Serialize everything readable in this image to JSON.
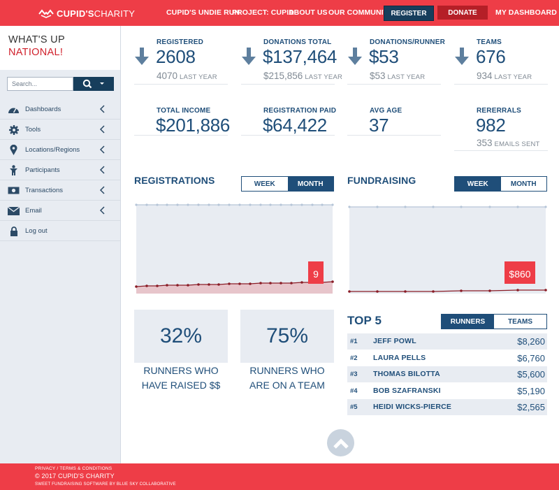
{
  "brand": {
    "name_bold": "CUPID'S",
    "name_light": "CHARITY"
  },
  "nav": {
    "links": [
      "CUPID'S UNDIE RUN",
      "PROJECT: CUPID",
      "ABOUT US",
      "OUR COMMUNITY"
    ],
    "register": "REGISTER",
    "donate": "DONATE",
    "dashboard": "MY DASHBOARD"
  },
  "sidebar": {
    "welcome_line1": "WHAT'S UP",
    "welcome_line2": "NATIONAL!",
    "search_placeholder": "Search...",
    "items": [
      {
        "label": "Dashboards",
        "icon": "dashboard-icon",
        "has_chevron": true
      },
      {
        "label": "Tools",
        "icon": "gear-icon",
        "has_chevron": true
      },
      {
        "label": "Locations/Regions",
        "icon": "map-pin-icon",
        "has_chevron": true
      },
      {
        "label": "Participants",
        "icon": "person-icon",
        "has_chevron": true
      },
      {
        "label": "Transactions",
        "icon": "money-icon",
        "has_chevron": true
      },
      {
        "label": "Email",
        "icon": "envelope-icon",
        "has_chevron": true
      },
      {
        "label": "Log out",
        "icon": "lock-icon",
        "has_chevron": false
      }
    ]
  },
  "stats": [
    {
      "label": "REGISTERED",
      "value": "2608",
      "sub_value": "4070",
      "sub_label": "LAST YEAR",
      "trend": "down"
    },
    {
      "label": "DONATIONS TOTAL",
      "value": "$137,464",
      "sub_value": "$215,856",
      "sub_label": "LAST YEAR",
      "trend": "down"
    },
    {
      "label": "DONATIONS/RUNNER",
      "value": "$53",
      "sub_value": "$53",
      "sub_label": "LAST YEAR",
      "trend": "down"
    },
    {
      "label": "TEAMS",
      "value": "676",
      "sub_value": "934",
      "sub_label": "LAST YEAR",
      "trend": "down"
    },
    {
      "label": "TOTAL INCOME",
      "value": "$201,886"
    },
    {
      "label": "REGISTRATION PAID",
      "value": "$64,422"
    },
    {
      "label": "AVG AGE",
      "value": "37"
    },
    {
      "label": "RERERRALS",
      "value": "982",
      "sub_value": "353",
      "sub_label": "EMAILS SENT"
    }
  ],
  "registrations": {
    "title": "REGISTRATIONS",
    "toggle": [
      "WEEK",
      "MONTH"
    ],
    "active": "MONTH",
    "tooltip": "9"
  },
  "fundraising": {
    "title": "FUNDRAISING",
    "toggle": [
      "WEEK",
      "MONTH"
    ],
    "active": "WEEK",
    "tooltip": "$860"
  },
  "percent_cards": [
    {
      "value": "32%",
      "line1": "RUNNERS WHO",
      "line2": "HAVE RAISED $$"
    },
    {
      "value": "75%",
      "line1": "RUNNERS WHO",
      "line2": "ARE ON A TEAM"
    }
  ],
  "top5": {
    "title": "TOP 5",
    "toggle": [
      "RUNNERS",
      "TEAMS"
    ],
    "active": "RUNNERS",
    "rows": [
      {
        "rank": "#1",
        "name": "JEFF POWL",
        "amount": "$8,260"
      },
      {
        "rank": "#2",
        "name": "LAURA PELLS",
        "amount": "$6,760"
      },
      {
        "rank": "#3",
        "name": "THOMAS BILOTTA",
        "amount": "$5,600"
      },
      {
        "rank": "#4",
        "name": "BOB SZAFRANSKI",
        "amount": "$5,190"
      },
      {
        "rank": "#5",
        "name": "HEIDI WICKS-PIERCE",
        "amount": "$2,565"
      }
    ]
  },
  "footer": {
    "links": "PRIVACY / TERMS & CONDITIONS",
    "copyright": "© 2017 CUPID'S CHARITY",
    "credit": "SWEET FUNDRAISING SOFTWARE BY BLUE SKY COLLABORATIVE"
  },
  "colors": {
    "brand_red": "#ee3d47",
    "navy": "#1f4e79",
    "dark_navy": "#173e5c",
    "donate_red": "#b51f27",
    "panel_gray": "#e8ecf2"
  }
}
